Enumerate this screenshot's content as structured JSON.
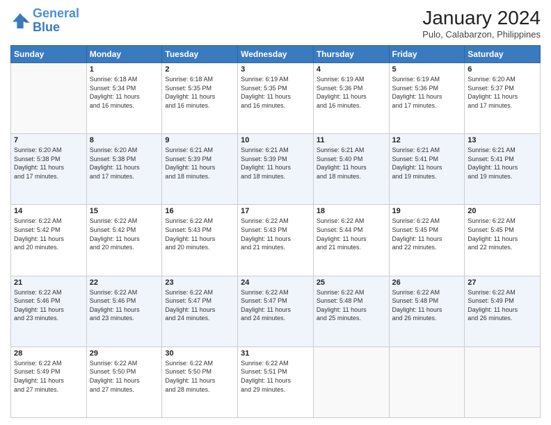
{
  "header": {
    "logo_line1": "General",
    "logo_line2": "Blue",
    "title": "January 2024",
    "subtitle": "Pulo, Calabarzon, Philippines"
  },
  "days_of_week": [
    "Sunday",
    "Monday",
    "Tuesday",
    "Wednesday",
    "Thursday",
    "Friday",
    "Saturday"
  ],
  "weeks": [
    [
      {
        "day": "",
        "info": ""
      },
      {
        "day": "1",
        "info": "Sunrise: 6:18 AM\nSunset: 5:34 PM\nDaylight: 11 hours\nand 16 minutes."
      },
      {
        "day": "2",
        "info": "Sunrise: 6:18 AM\nSunset: 5:35 PM\nDaylight: 11 hours\nand 16 minutes."
      },
      {
        "day": "3",
        "info": "Sunrise: 6:19 AM\nSunset: 5:35 PM\nDaylight: 11 hours\nand 16 minutes."
      },
      {
        "day": "4",
        "info": "Sunrise: 6:19 AM\nSunset: 5:36 PM\nDaylight: 11 hours\nand 16 minutes."
      },
      {
        "day": "5",
        "info": "Sunrise: 6:19 AM\nSunset: 5:36 PM\nDaylight: 11 hours\nand 17 minutes."
      },
      {
        "day": "6",
        "info": "Sunrise: 6:20 AM\nSunset: 5:37 PM\nDaylight: 11 hours\nand 17 minutes."
      }
    ],
    [
      {
        "day": "7",
        "info": "Sunrise: 6:20 AM\nSunset: 5:38 PM\nDaylight: 11 hours\nand 17 minutes."
      },
      {
        "day": "8",
        "info": "Sunrise: 6:20 AM\nSunset: 5:38 PM\nDaylight: 11 hours\nand 17 minutes."
      },
      {
        "day": "9",
        "info": "Sunrise: 6:21 AM\nSunset: 5:39 PM\nDaylight: 11 hours\nand 18 minutes."
      },
      {
        "day": "10",
        "info": "Sunrise: 6:21 AM\nSunset: 5:39 PM\nDaylight: 11 hours\nand 18 minutes."
      },
      {
        "day": "11",
        "info": "Sunrise: 6:21 AM\nSunset: 5:40 PM\nDaylight: 11 hours\nand 18 minutes."
      },
      {
        "day": "12",
        "info": "Sunrise: 6:21 AM\nSunset: 5:41 PM\nDaylight: 11 hours\nand 19 minutes."
      },
      {
        "day": "13",
        "info": "Sunrise: 6:21 AM\nSunset: 5:41 PM\nDaylight: 11 hours\nand 19 minutes."
      }
    ],
    [
      {
        "day": "14",
        "info": "Sunrise: 6:22 AM\nSunset: 5:42 PM\nDaylight: 11 hours\nand 20 minutes."
      },
      {
        "day": "15",
        "info": "Sunrise: 6:22 AM\nSunset: 5:42 PM\nDaylight: 11 hours\nand 20 minutes."
      },
      {
        "day": "16",
        "info": "Sunrise: 6:22 AM\nSunset: 5:43 PM\nDaylight: 11 hours\nand 20 minutes."
      },
      {
        "day": "17",
        "info": "Sunrise: 6:22 AM\nSunset: 5:43 PM\nDaylight: 11 hours\nand 21 minutes."
      },
      {
        "day": "18",
        "info": "Sunrise: 6:22 AM\nSunset: 5:44 PM\nDaylight: 11 hours\nand 21 minutes."
      },
      {
        "day": "19",
        "info": "Sunrise: 6:22 AM\nSunset: 5:45 PM\nDaylight: 11 hours\nand 22 minutes."
      },
      {
        "day": "20",
        "info": "Sunrise: 6:22 AM\nSunset: 5:45 PM\nDaylight: 11 hours\nand 22 minutes."
      }
    ],
    [
      {
        "day": "21",
        "info": "Sunrise: 6:22 AM\nSunset: 5:46 PM\nDaylight: 11 hours\nand 23 minutes."
      },
      {
        "day": "22",
        "info": "Sunrise: 6:22 AM\nSunset: 5:46 PM\nDaylight: 11 hours\nand 23 minutes."
      },
      {
        "day": "23",
        "info": "Sunrise: 6:22 AM\nSunset: 5:47 PM\nDaylight: 11 hours\nand 24 minutes."
      },
      {
        "day": "24",
        "info": "Sunrise: 6:22 AM\nSunset: 5:47 PM\nDaylight: 11 hours\nand 24 minutes."
      },
      {
        "day": "25",
        "info": "Sunrise: 6:22 AM\nSunset: 5:48 PM\nDaylight: 11 hours\nand 25 minutes."
      },
      {
        "day": "26",
        "info": "Sunrise: 6:22 AM\nSunset: 5:48 PM\nDaylight: 11 hours\nand 26 minutes."
      },
      {
        "day": "27",
        "info": "Sunrise: 6:22 AM\nSunset: 5:49 PM\nDaylight: 11 hours\nand 26 minutes."
      }
    ],
    [
      {
        "day": "28",
        "info": "Sunrise: 6:22 AM\nSunset: 5:49 PM\nDaylight: 11 hours\nand 27 minutes."
      },
      {
        "day": "29",
        "info": "Sunrise: 6:22 AM\nSunset: 5:50 PM\nDaylight: 11 hours\nand 27 minutes."
      },
      {
        "day": "30",
        "info": "Sunrise: 6:22 AM\nSunset: 5:50 PM\nDaylight: 11 hours\nand 28 minutes."
      },
      {
        "day": "31",
        "info": "Sunrise: 6:22 AM\nSunset: 5:51 PM\nDaylight: 11 hours\nand 29 minutes."
      },
      {
        "day": "",
        "info": ""
      },
      {
        "day": "",
        "info": ""
      },
      {
        "day": "",
        "info": ""
      }
    ]
  ]
}
